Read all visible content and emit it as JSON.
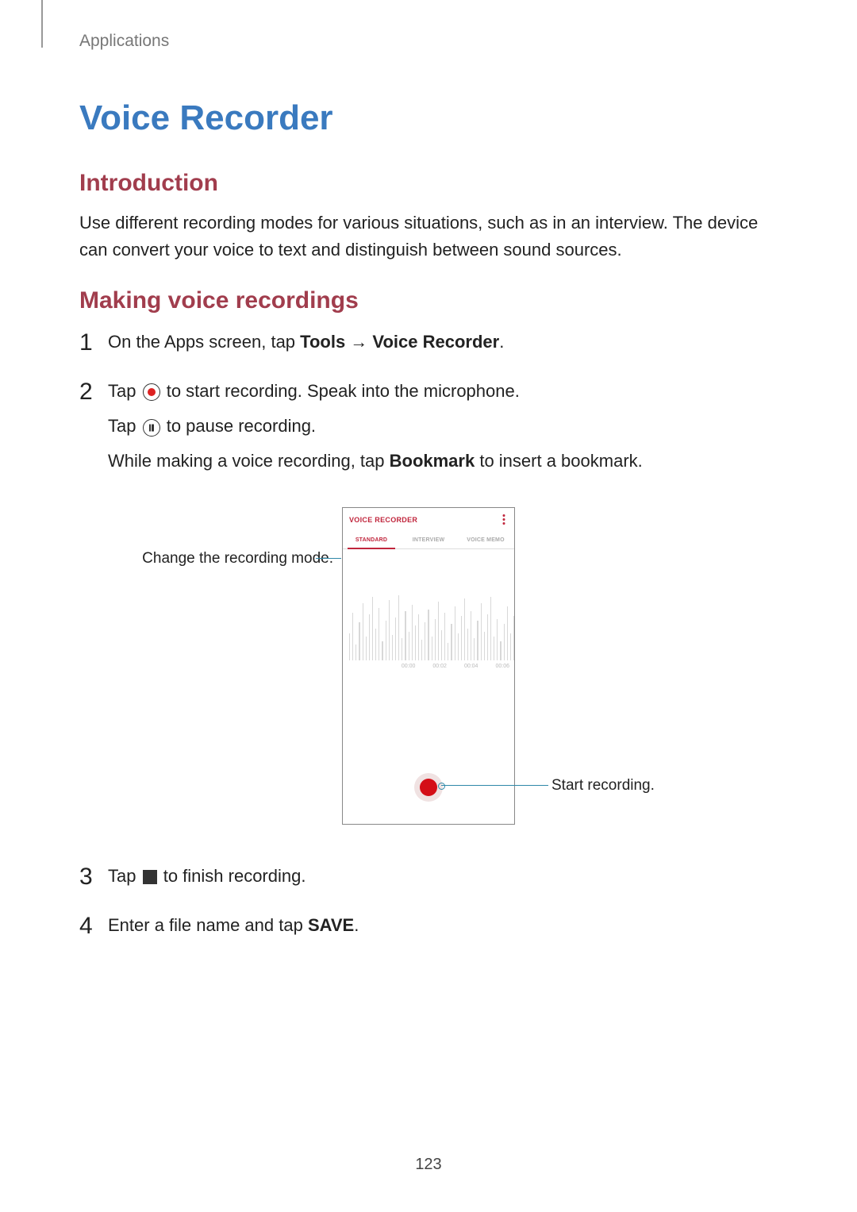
{
  "header": {
    "section": "Applications"
  },
  "title": "Voice Recorder",
  "intro": {
    "heading": "Introduction",
    "body": "Use different recording modes for various situations, such as in an interview. The device can convert your voice to text and distinguish between sound sources."
  },
  "making": {
    "heading": "Making voice recordings",
    "step1_a": "On the Apps screen, tap ",
    "step1_b_bold": "Tools",
    "step1_c": " → ",
    "step1_d_bold": "Voice Recorder",
    "step1_e": ".",
    "step2_a": "Tap ",
    "step2_b": " to start recording. Speak into the microphone.",
    "step2_c": "Tap ",
    "step2_d": " to pause recording.",
    "step2_e": "While making a voice recording, tap ",
    "step2_f_bold": "Bookmark",
    "step2_g": " to insert a bookmark.",
    "step3_a": "Tap ",
    "step3_b": " to finish recording.",
    "step4_a": "Enter a file name and tap ",
    "step4_b_bold": "SAVE",
    "step4_c": "."
  },
  "figure": {
    "phone_title": "VOICE RECORDER",
    "tabs": [
      "STANDARD",
      "INTERVIEW",
      "VOICE MEMO"
    ],
    "selected_tab": 0,
    "times": [
      "00:00",
      "00:02",
      "00:04",
      "00:06"
    ],
    "callout_left": "Change the recording mode.",
    "callout_right": "Start recording.",
    "wave_heights": [
      34,
      60,
      20,
      48,
      72,
      30,
      58,
      80,
      40,
      66,
      24,
      50,
      76,
      32,
      54,
      82,
      28,
      62,
      36,
      70,
      44,
      58,
      26,
      48,
      64,
      30,
      52,
      74,
      38,
      60,
      22,
      46,
      68,
      34,
      56,
      78,
      40,
      62,
      28,
      50,
      72,
      36,
      58,
      80,
      30,
      52,
      24,
      46,
      68,
      34,
      56
    ]
  },
  "page_number": "123"
}
